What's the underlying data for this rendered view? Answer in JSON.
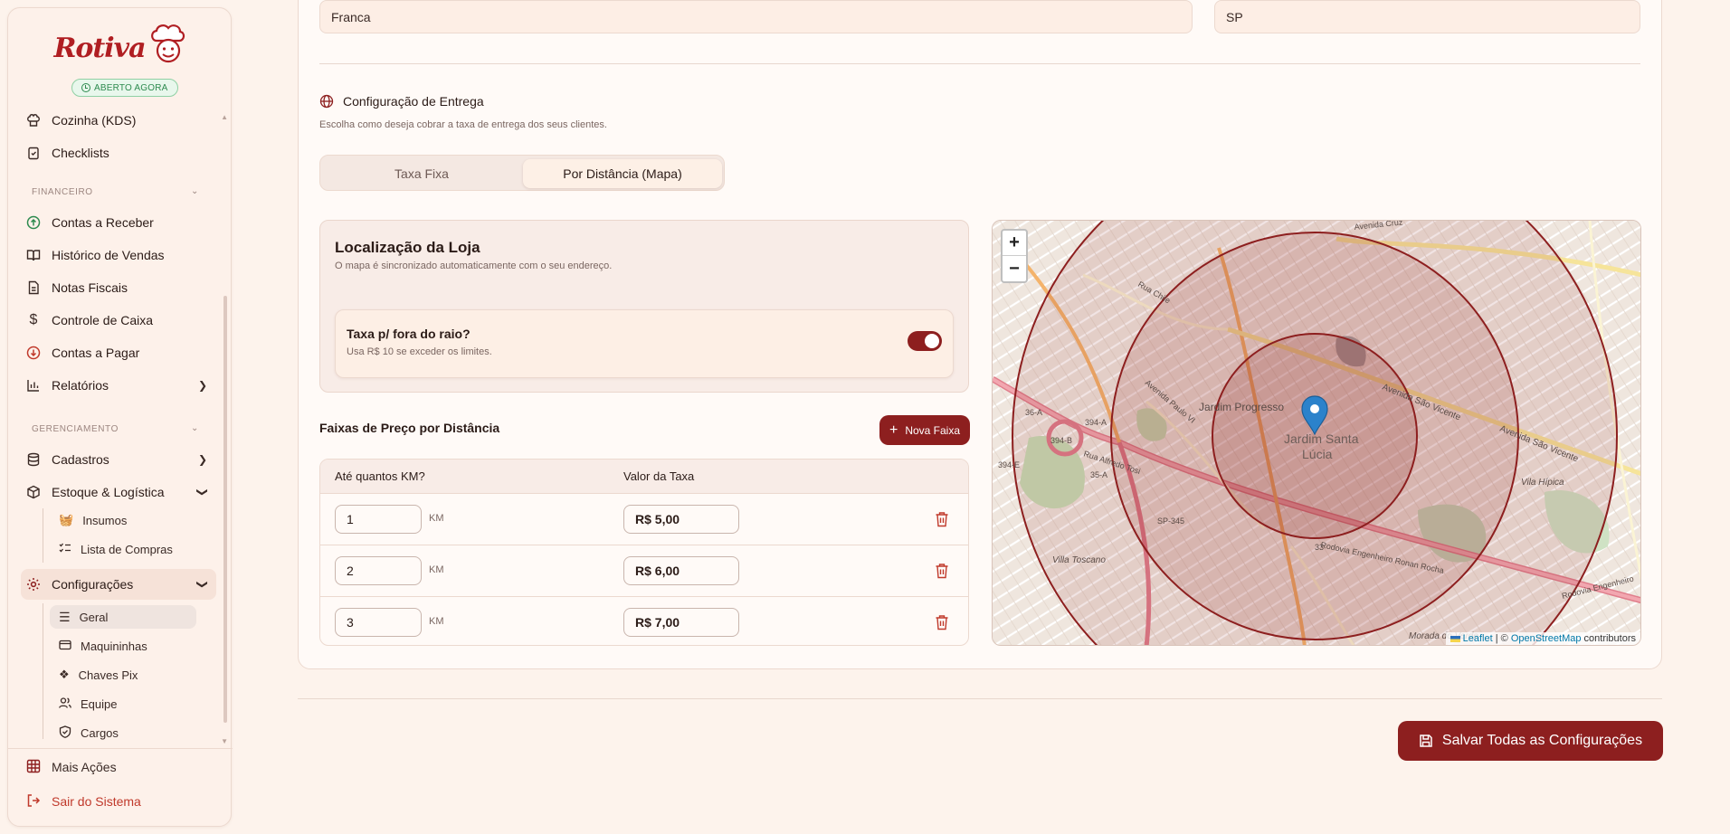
{
  "brand": {
    "name": "Rotiva",
    "status_badge": "ABERTO AGORA"
  },
  "sidebar": {
    "items_top": [
      {
        "label": "Cozinha (KDS)",
        "icon": "chef-hat-icon"
      },
      {
        "label": "Checklists",
        "icon": "clipboard-check-icon"
      }
    ],
    "sections": {
      "financeiro": "FINANCEIRO",
      "gerenciamento": "GERENCIAMENTO"
    },
    "financeiro_items": [
      {
        "label": "Contas a Receber",
        "icon": "arrow-up-circle-icon",
        "color": "#2d8a4e"
      },
      {
        "label": "Histórico de Vendas",
        "icon": "book-open-icon"
      },
      {
        "label": "Notas Fiscais",
        "icon": "file-text-icon"
      },
      {
        "label": "Controle de Caixa",
        "icon": "dollar-sign-icon"
      },
      {
        "label": "Contas a Pagar",
        "icon": "arrow-down-circle-icon",
        "color": "#c0392b"
      },
      {
        "label": "Relatórios",
        "icon": "bar-chart-icon"
      }
    ],
    "gerenciamento_items": [
      {
        "label": "Cadastros",
        "icon": "database-icon"
      },
      {
        "label": "Estoque & Logística",
        "icon": "package-icon"
      }
    ],
    "estoque_sub": [
      {
        "label": "Insumos",
        "icon": "basket-icon"
      },
      {
        "label": "Lista de Compras",
        "icon": "list-checks-icon"
      }
    ],
    "configuracoes": {
      "label": "Configurações",
      "icon": "settings-icon",
      "color": "#8d1f1f"
    },
    "config_sub": [
      {
        "label": "Geral",
        "icon": "menu-icon",
        "active": true
      },
      {
        "label": "Maquininhas",
        "icon": "credit-card-icon"
      },
      {
        "label": "Chaves Pix",
        "icon": "pix-icon"
      },
      {
        "label": "Equipe",
        "icon": "users-icon"
      },
      {
        "label": "Cargos",
        "icon": "shield-check-icon"
      }
    ],
    "bottom": {
      "more": "Mais Ações",
      "logout": "Sair do Sistema"
    }
  },
  "address": {
    "city": "Franca",
    "state": "SP"
  },
  "delivery": {
    "title": "Configuração de Entrega",
    "subtitle": "Escolha como deseja cobrar a taxa de entrega dos seus clientes.",
    "tabs": [
      {
        "label": "Taxa Fixa",
        "active": false
      },
      {
        "label": "Por Distância (Mapa)",
        "active": true
      }
    ],
    "location": {
      "title": "Localização da Loja",
      "subtitle": "O mapa é sincronizado automaticamente com o seu endereço.",
      "toggle_title": "Taxa p/ fora do raio?",
      "toggle_sub": "Usa R$ 10 se exceder os limites.",
      "toggle_on": true
    },
    "ranges": {
      "title": "Faixas de Preço por Distância",
      "add_label": "Nova Faixa",
      "col_km": "Até quantos KM?",
      "col_value": "Valor da Taxa",
      "unit": "KM",
      "rows": [
        {
          "km": "1",
          "value": "R$ 5,00"
        },
        {
          "km": "2",
          "value": "R$ 6,00"
        },
        {
          "km": "3",
          "value": "R$ 7,00"
        }
      ]
    }
  },
  "map": {
    "zoom_in": "+",
    "zoom_out": "−",
    "place_labels": [
      "Jardim Progresso",
      "Jardim Santa",
      "Lúcia",
      "Villa Toscano",
      "Vila Hípica",
      "Morada do Verde"
    ],
    "road_labels": [
      "Avenida São Vicente",
      "Avenida São Vicente",
      "Rodovia Engenheiro Ronan Rocha",
      "Rodovia Engenheiro",
      "Avenida Paulo VI",
      "Rua Alfredo Tosi",
      "Rua Chile",
      "SP-345",
      "36-A",
      "394-A",
      "394-B",
      "35-A",
      "33",
      "394-E",
      "Avenida Cruz"
    ],
    "attribution_leaflet": "Leaflet",
    "attribution_sep": " | © ",
    "attribution_osm": "OpenStreetMap",
    "attribution_tail": " contributors",
    "accent": "#8d1f1f"
  },
  "footer": {
    "save_label": "Salvar Todas as Configurações"
  }
}
